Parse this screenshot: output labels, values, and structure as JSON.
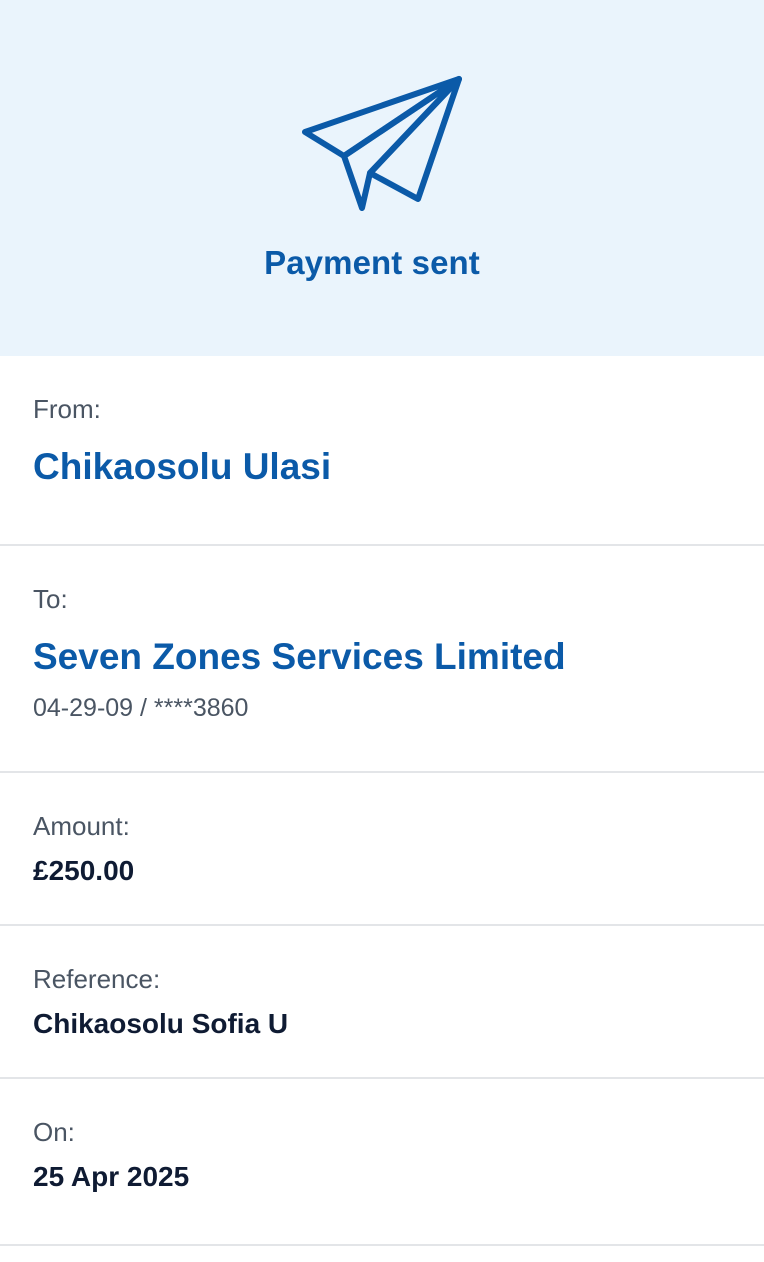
{
  "header": {
    "icon": "paper-plane-icon",
    "title": "Payment sent",
    "accent_color": "#0b5aa8",
    "background_color": "#eaf4fc"
  },
  "details": {
    "from": {
      "label": "From:",
      "name": "Chikaosolu Ulasi"
    },
    "to": {
      "label": "To:",
      "name": "Seven Zones Services Limited",
      "account": "04-29-09 / ****3860"
    },
    "amount": {
      "label": "Amount:",
      "value": "£250.00"
    },
    "reference": {
      "label": "Reference:",
      "value": "Chikaosolu Sofia U"
    },
    "date": {
      "label": "On:",
      "value": "25 Apr 2025"
    }
  }
}
